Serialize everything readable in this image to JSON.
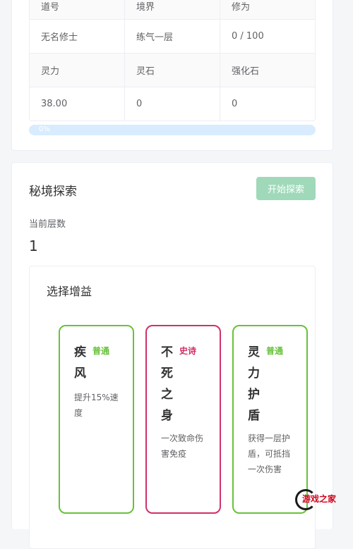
{
  "stats": {
    "headers_row1": [
      "道号",
      "境界",
      "修为"
    ],
    "values_row1": [
      "无名修士",
      "练气一层",
      "0 / 100"
    ],
    "headers_row2": [
      "灵力",
      "灵石",
      "强化石"
    ],
    "values_row2": [
      "38.00",
      "0",
      "0"
    ],
    "progress_label": "0%",
    "progress_fraction": 0
  },
  "explore": {
    "title": "秘境探索",
    "start_button": "开始探索",
    "floor_label": "当前层数",
    "floor_value": "1",
    "buff_title": "选择增益",
    "cards": [
      {
        "name": "疾风",
        "rarity": "普通",
        "desc": "提升15%速度"
      },
      {
        "name": "不死之身",
        "rarity": "史诗",
        "desc": "一次致命伤害免疫"
      },
      {
        "name": "灵力护盾",
        "rarity": "普通",
        "desc": "获得一层护盾，可抵挡一次伤害"
      }
    ]
  },
  "watermark": {
    "text": "游戏之家"
  },
  "colors": {
    "common": "#67c23a",
    "epic": "#d0306a",
    "button": "#a0d9b9",
    "progress_track": "#d9ecff"
  }
}
